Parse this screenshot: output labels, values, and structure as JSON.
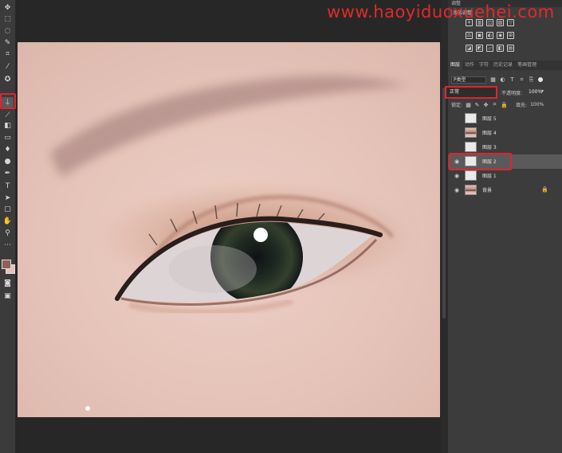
{
  "watermark": "www.haoyiduoxuehei.com",
  "toolbar": {
    "tools": [
      {
        "icon": "move-icon",
        "glyph": "✥"
      },
      {
        "icon": "marquee-icon",
        "glyph": "⬚"
      },
      {
        "icon": "lasso-icon",
        "glyph": "◌"
      },
      {
        "icon": "magic-wand-icon",
        "glyph": "✎"
      },
      {
        "icon": "crop-icon",
        "glyph": "⌗"
      },
      {
        "icon": "eyedropper-icon",
        "glyph": "⁄"
      },
      {
        "icon": "patch-icon",
        "glyph": "✪"
      },
      {
        "icon": "clone-stamp-icon",
        "glyph": "⍊"
      },
      {
        "icon": "history-brush-icon",
        "glyph": "⟋"
      },
      {
        "icon": "eraser-icon",
        "glyph": "◧"
      },
      {
        "icon": "gradient-icon",
        "glyph": "▭"
      },
      {
        "icon": "blur-icon",
        "glyph": "♦"
      },
      {
        "icon": "dodge-icon",
        "glyph": "●"
      },
      {
        "icon": "pen-icon",
        "glyph": "✒"
      },
      {
        "icon": "type-icon",
        "glyph": "T"
      },
      {
        "icon": "path-select-icon",
        "glyph": "➤"
      },
      {
        "icon": "rectangle-icon",
        "glyph": "▢"
      },
      {
        "icon": "hand-icon",
        "glyph": "✋"
      },
      {
        "icon": "zoom-icon",
        "glyph": "⚲"
      },
      {
        "icon": "more-icon",
        "glyph": "⋯"
      }
    ],
    "foreground_color": "#8f5f58",
    "background_color": "#e4c3b9"
  },
  "adjustments": {
    "header": "调整",
    "title": "添加调整",
    "row1": [
      "☀",
      "▥",
      "◫",
      "▨",
      "▽"
    ],
    "row2": [
      "⚖",
      "▣",
      "◐",
      "◉",
      "⊞"
    ],
    "row3": [
      "◪",
      "◩",
      "▱",
      "◧",
      "▤"
    ]
  },
  "layers_panel": {
    "tabs": [
      "图层",
      "动作",
      "字符",
      "历史记录",
      "笔画管理"
    ],
    "filter_label": "P类型",
    "filter_icons": [
      "▦",
      "◐",
      "T",
      "⌗",
      "⎘"
    ],
    "blend_mode": "正常",
    "opacity_label": "不透明度:",
    "opacity_value": "100%",
    "lock_label": "锁定:",
    "lock_icons": [
      "▦",
      "✎",
      "✥",
      "⌗",
      "🔒"
    ],
    "fill_label": "填充:",
    "fill_value": "100%",
    "layers": [
      {
        "name": "图层 5",
        "visible": false,
        "thumb": "white",
        "locked": false,
        "selected": false
      },
      {
        "name": "图层 4",
        "visible": false,
        "thumb": "eye",
        "locked": false,
        "selected": false
      },
      {
        "name": "图层 3",
        "visible": false,
        "thumb": "white",
        "locked": false,
        "selected": false
      },
      {
        "name": "图层 2",
        "visible": true,
        "thumb": "white",
        "locked": false,
        "selected": true
      },
      {
        "name": "图层 1",
        "visible": true,
        "thumb": "white",
        "locked": false,
        "selected": false
      },
      {
        "name": "背景",
        "visible": true,
        "thumb": "eye",
        "locked": true,
        "selected": false
      }
    ]
  },
  "colors": {
    "highlight": "#e0242f",
    "panel_bg": "#3c3c3c",
    "selected_row": "#5a5a5a"
  }
}
